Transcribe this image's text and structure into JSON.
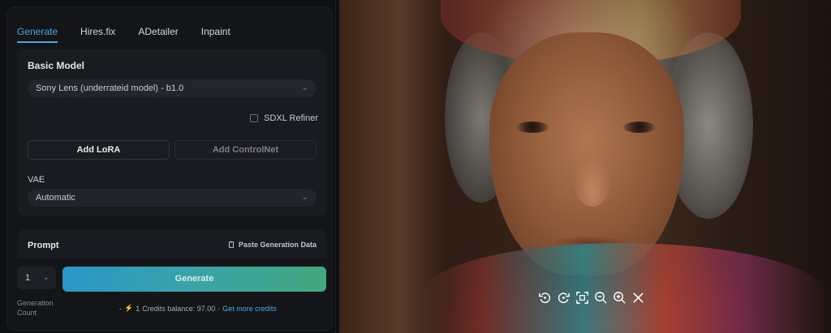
{
  "tabs": [
    {
      "label": "Generate",
      "active": true
    },
    {
      "label": "Hires.fix",
      "active": false
    },
    {
      "label": "ADetailer",
      "active": false
    },
    {
      "label": "Inpaint",
      "active": false
    }
  ],
  "basic_model": {
    "title": "Basic Model",
    "selected": "Sony Lens (underrateid model) - b1.0",
    "refiner_label": "SDXL Refiner",
    "refiner_checked": false
  },
  "buttons": {
    "add_lora": "Add LoRA",
    "add_controlnet": "Add ControlNet"
  },
  "vae": {
    "label": "VAE",
    "selected": "Automatic"
  },
  "prompt": {
    "title": "Prompt",
    "paste_label": "Paste Generation Data"
  },
  "generation": {
    "count_value": "1",
    "count_label": "Generation Count",
    "generate_label": "Generate"
  },
  "credits": {
    "prefix": "-",
    "cost": "1",
    "balance_text": "Credits balance: 97.00",
    "separator": "·",
    "more_link": "Get more credits"
  },
  "image_toolbar": [
    "rotate-left-icon",
    "rotate-right-icon",
    "fit-screen-icon",
    "zoom-out-icon",
    "zoom-in-icon",
    "close-icon"
  ],
  "colors": {
    "accent": "#4aa8de",
    "generate_gradient_start": "#2a97c8",
    "generate_gradient_end": "#43a67c"
  }
}
